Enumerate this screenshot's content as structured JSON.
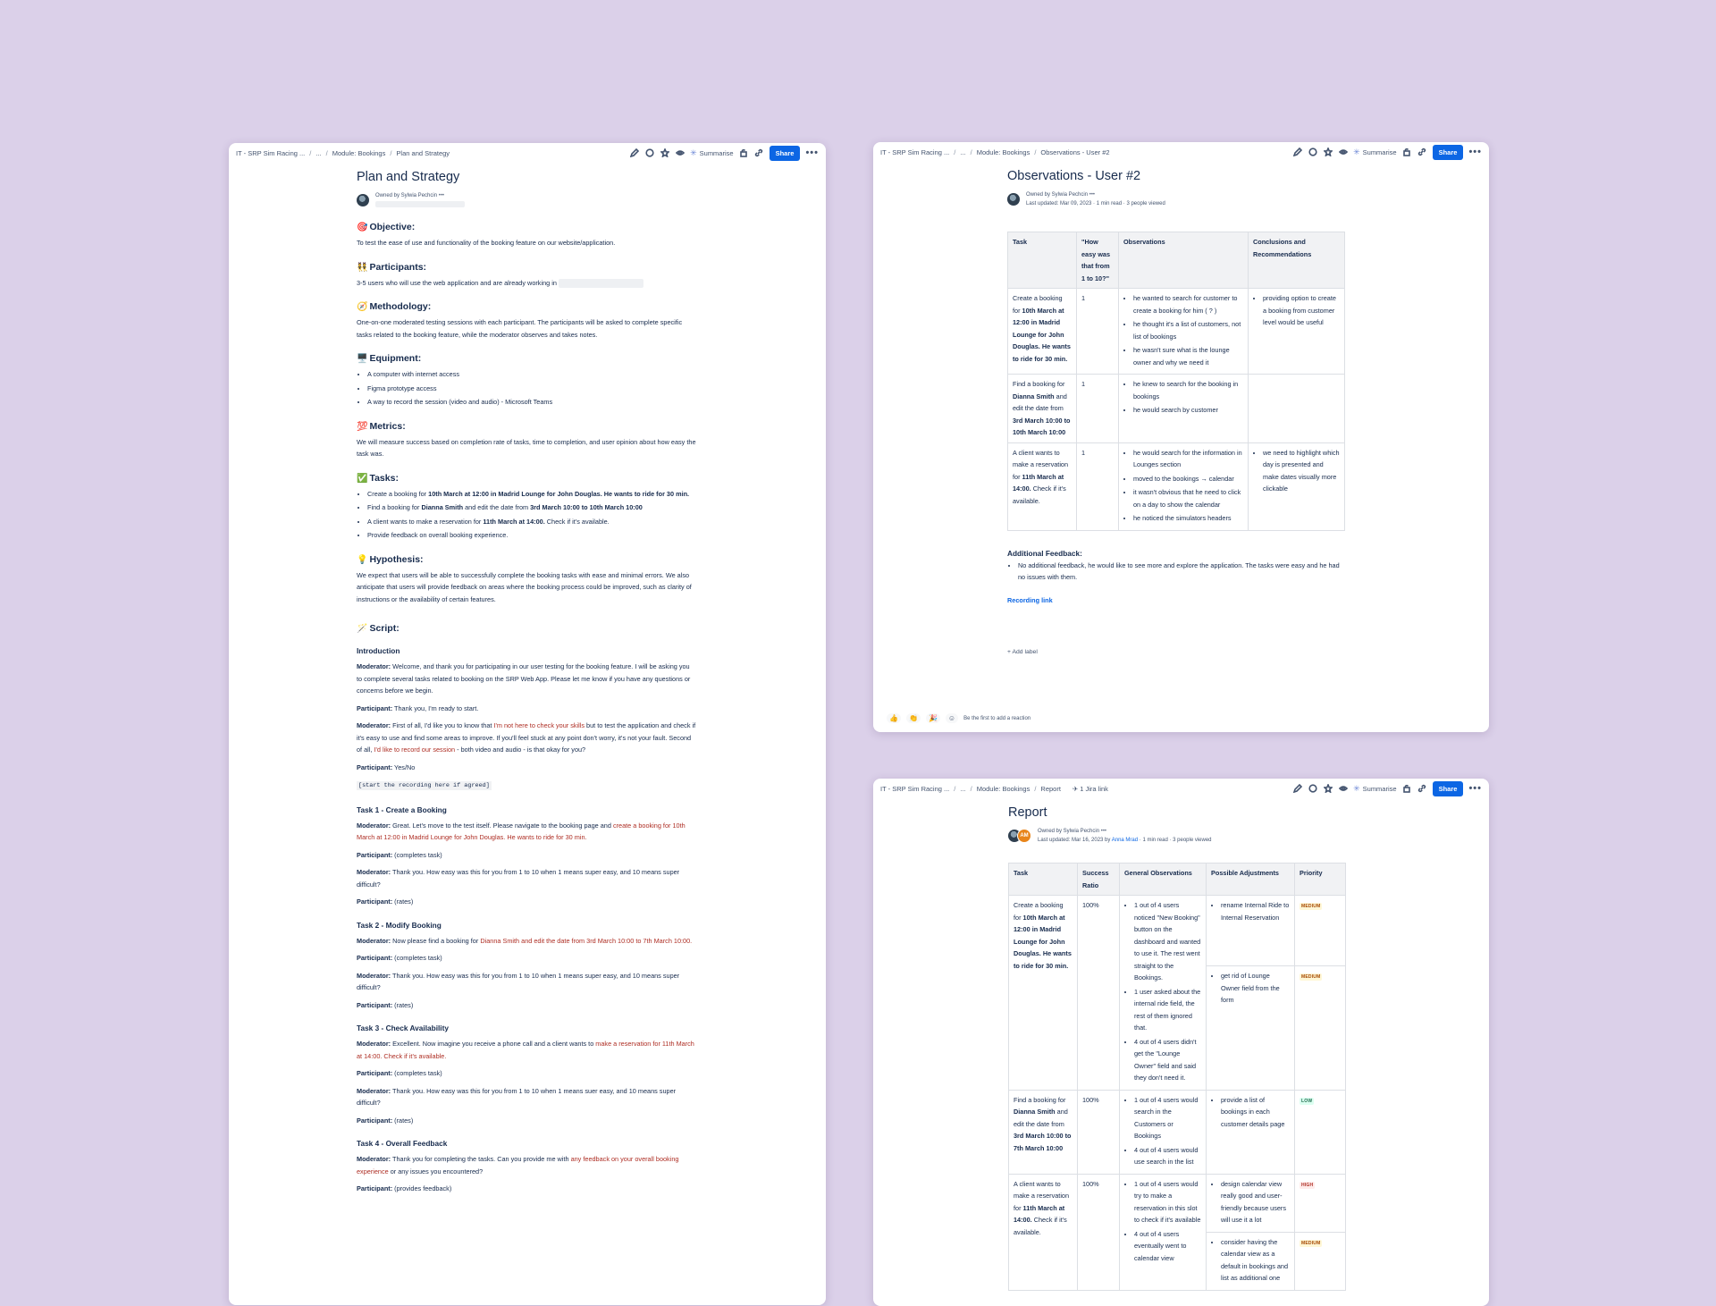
{
  "plan": {
    "breadcrumbs": [
      "IT - SRP Sim Racing ...",
      "...",
      "Module: Bookings",
      "Plan and Strategy"
    ],
    "toolbar": {
      "summarise": "Summarise",
      "share": "Share",
      "more": "•••"
    },
    "title": "Plan and Strategy",
    "owned_by": "Owned by Sylwia Pechcin",
    "sections": {
      "objective": {
        "emoji": "🎯",
        "heading": "Objective:",
        "text": "To test the ease of use and functionality of the booking feature on our website/application."
      },
      "participants": {
        "emoji": "👯",
        "heading": "Participants:",
        "text": "3-5 users who will use the web application and are already working in"
      },
      "methodology": {
        "emoji": "🧭",
        "heading": "Methodology:",
        "text": "One-on-one moderated testing sessions with each participant. The participants will be asked to complete specific tasks related to the booking feature, while the moderator observes and takes notes."
      },
      "equipment": {
        "emoji": "🖥️",
        "heading": "Equipment:",
        "items": [
          "A computer with internet access",
          "Figma prototype access",
          "A way to record the session (video and audio) - Microsoft Teams"
        ]
      },
      "metrics": {
        "emoji": "💯",
        "heading": "Metrics:",
        "text": "We will measure success based on completion rate of tasks, time to completion, and user opinion about how easy the task was."
      },
      "tasks": {
        "emoji": "✅",
        "heading": "Tasks:",
        "t1_pre": "Create a booking for ",
        "t1_bold": "10th March at 12:00 in Madrid Lounge for John Douglas. He wants to ride for 30 min.",
        "t2_pre": "Find a booking for ",
        "t2_b1": "Dianna Smith",
        "t2_mid": " and edit the date from ",
        "t2_b2": "3rd March 10:00 to 10th March 10:00",
        "t3_pre": "A client wants to make a reservation for ",
        "t3_bold": "11th March at 14:00.",
        "t3_post": " Check if it's available.",
        "t4": "Provide feedback on overall booking experience."
      },
      "hypothesis": {
        "emoji": "💡",
        "heading": "Hypothesis:",
        "text": "We expect that users will be able to successfully complete the booking tasks with ease and minimal errors. We also anticipate that users will provide feedback on areas where the booking process could be improved, such as clarity of instructions or the availability of certain features."
      },
      "script": {
        "emoji": "🪄",
        "heading": "Script:"
      }
    },
    "script": {
      "intro_heading": "Introduction",
      "moderator": "Moderator:",
      "participant": "Participant:",
      "intro_mod": "Welcome, and thank you for participating in our user testing for the booking feature. I will be asking you to complete several tasks related to booking on the SRP Web App. Please let me know if you have any questions or concerns before we begin.",
      "intro_part": "Thank you, I'm ready to start.",
      "intro_mod2_a": "First of all, I'd like you to know that ",
      "intro_mod2_r1": "I'm not here to check your skills",
      "intro_mod2_b": " but to test the application and check if it's easy to use and find some areas to improve. If you'll feel stuck at any point don't worry, it's not your fault. Second of all, ",
      "intro_mod2_r2": "I'd like to record our session",
      "intro_mod2_c": " - both video and audio - is that okay for you?",
      "intro_part2": "Yes/No",
      "recording_note": "[start the recording here if agreed]",
      "task1_heading": "Task 1 - Create a Booking",
      "task1_mod_a": "Great. Let's move to the test itself. Please navigate to the booking page and ",
      "task1_mod_r": "create a booking for 10th March at 12:00 in Madrid Lounge for John Douglas. He wants to ride for 30 min.",
      "completes": "(completes task)",
      "rate_q": "Thank you. How easy was this for you from 1 to 10 when 1 means super easy, and 10 means super difficult?",
      "rate_q3": "Thank you. How easy was this for you from 1 to 10 when 1 means suer easy, and 10 means super difficult?",
      "rates": "(rates)",
      "task2_heading": "Task 2 - Modify Booking",
      "task2_mod_a": "Now please find a booking for ",
      "task2_mod_r": "Dianna Smith and edit the date from 3rd March 10:00 to 7th March 10:00.",
      "task3_heading": "Task 3 - Check Availability",
      "task3_mod_a": "Excellent. Now imagine you receive a phone call and a client wants to ",
      "task3_mod_r": "make a reservation for 11th March at 14:00. Check if it's available.",
      "task4_heading": "Task 4 - Overall Feedback",
      "task4_mod_a": "Thank you for completing the tasks. Can you provide me with ",
      "task4_mod_r": "any feedback on your overall booking experience",
      "task4_mod_b": " or any issues you encountered?",
      "task4_part": "(provides feedback)"
    }
  },
  "observations": {
    "breadcrumbs": [
      "IT - SRP Sim Racing ...",
      "...",
      "Module: Bookings",
      "Observations - User #2"
    ],
    "toolbar": {
      "summarise": "Summarise",
      "share": "Share",
      "more": "•••"
    },
    "title": "Observations - User #2",
    "owned_by": "Owned by Sylwia Pechcin",
    "meta": {
      "updated": "Last updated: Mar 09, 2023",
      "read": "1 min read",
      "viewed": "3 people viewed"
    },
    "table": {
      "headers": [
        "Task",
        "\"How easy was that from 1 to 10?\"",
        "Observations",
        "Conclusions and Recommendations"
      ],
      "row1": {
        "task_pre": "Create a booking for ",
        "task_bold": "10th March at 12:00 in Madrid Lounge for John Douglas. He wants to ride for 30 min.",
        "score": "1",
        "obs": [
          "he wanted to search for customer to create a booking for him ( ? )",
          "he thought it's a list of customers, not list of bookings",
          "he wasn't sure what is the lounge owner and why we need it"
        ],
        "rec": [
          "providing option to create a booking from customer level would be useful"
        ]
      },
      "row2": {
        "task_pre": "Find a booking for ",
        "task_b1": "Dianna Smith",
        "task_mid": " and edit the date from ",
        "task_b2": "3rd March 10:00 to 10th March 10:00",
        "score": "1",
        "obs": [
          "he knew to search for the booking in bookings",
          "he would search by customer"
        ]
      },
      "row3": {
        "task_pre": "A client wants to make a reservation for ",
        "task_bold": "11th March at 14:00.",
        "task_post": " Check if it's available.",
        "score": "1",
        "obs": [
          "he would search for the information in Lounges section",
          "moved to the bookings → calendar",
          "it wasn't obvious that he need to click on a day to show the calendar",
          "he noticed the simulators headers"
        ],
        "rec": [
          "we need to highlight which day is presented and make dates visually more clickable"
        ]
      }
    },
    "feedback_heading": "Additional Feedback:",
    "feedback_item": "No additional feedback, he would like to see more and explore the application. The tasks were easy and he had no issues with them.",
    "recording_link": "Recording link",
    "add_label": "+ Add label",
    "reaction_text": "Be the first to add a reaction"
  },
  "report": {
    "breadcrumbs": [
      "IT - SRP Sim Racing ...",
      "...",
      "Module: Bookings",
      "Report"
    ],
    "jira": "1 Jira link",
    "toolbar": {
      "summarise": "Summarise",
      "share": "Share",
      "more": "•••"
    },
    "title": "Report",
    "owned_by": "Owned by Sylwia Pechcin",
    "meta": {
      "updated_pre": "Last updated: Mar 16, 2023 by ",
      "updated_by": "Anna Mrad",
      "read": "1 min read",
      "viewed": "3 people viewed"
    },
    "avatar2": "AM",
    "table": {
      "headers": [
        "Task",
        "Success Ratio",
        "General Observations",
        "Possible Adjustments",
        "Priority"
      ],
      "row1": {
        "task_pre": "Create a booking for ",
        "task_bold": "10th March at 12:00 in Madrid Lounge for John Douglas. He wants to ride for 30 min.",
        "ratio": "100%",
        "obs": [
          "1 out of 4 users noticed \"New Booking\" button on the dashboard and wanted to use it. The rest went straight to the Bookings.",
          "1 user asked about the internal ride field, the rest of them ignored that.",
          "4 out of 4 users didn't get the \"Lounge Owner\" field and said they don't need it."
        ],
        "adj1": "rename Internal Ride to Internal Reservation",
        "pri1": "MEDIUM",
        "adj2": "get rid of Lounge Owner field from the form",
        "pri2": "MEDIUM"
      },
      "row2": {
        "task_pre": "Find a booking for ",
        "task_b1": "Dianna Smith",
        "task_mid": " and edit the date from ",
        "task_b2": "3rd March 10:00 to 7th March 10:00",
        "ratio": "100%",
        "obs": [
          "1 out of 4 users would search in the Customers or Bookings",
          "4 out of 4 users would use search in the list"
        ],
        "adj1": "provide a list of bookings in each customer details page",
        "pri1": "LOW"
      },
      "row3": {
        "task_pre": "A client wants to make a reservation for ",
        "task_bold": "11th March at 14:00.",
        "task_post": " Check if it's available.",
        "ratio": "100%",
        "obs": [
          "1 out of 4 users would try to make a reservation in this slot to check if it's available",
          "4 out of 4 users eventually went to calendar view"
        ],
        "adj1": "design calendar view really good and user-friendly because users will use it a lot",
        "pri1": "HIGH",
        "adj2": "consider having the calendar view as a default in bookings and list as additional one",
        "pri2": "MEDIUM"
      }
    }
  },
  "colors": {
    "background": "#dbd0e9",
    "share": "#0c66e4",
    "link": "#0c66e4",
    "red_text": "#ae2e24"
  },
  "icons": [
    "pencil-icon",
    "comment-icon",
    "star-icon",
    "watch-icon",
    "sparkle-icon",
    "restrict-icon",
    "link-icon",
    "more-icon",
    "jira-icon"
  ]
}
